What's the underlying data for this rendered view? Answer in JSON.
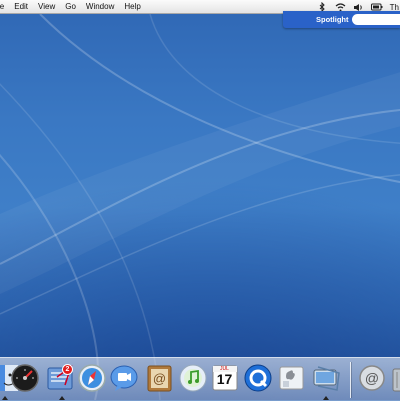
{
  "menubar": {
    "items": [
      "le",
      "Edit",
      "View",
      "Go",
      "Window",
      "Help"
    ],
    "clock": "Th",
    "status_icons": [
      "bluetooth-icon",
      "wifi-icon",
      "volume-icon",
      "battery-icon"
    ]
  },
  "spotlight": {
    "label": "Spotlight",
    "query": ""
  },
  "dock": {
    "apps": [
      "finder",
      "dashboard",
      "mail",
      "safari",
      "ichat",
      "address-book",
      "itunes",
      "ical",
      "quicktime",
      "preview",
      "system-preferences",
      "mail-folder",
      "trash"
    ],
    "mail_badge": "2",
    "calendar": {
      "month": "JUL",
      "day": "17"
    }
  },
  "colors": {
    "wallpaper": "#3a78c3",
    "spotlight": "#2a62c8",
    "menubar": "#f0f0f0"
  }
}
